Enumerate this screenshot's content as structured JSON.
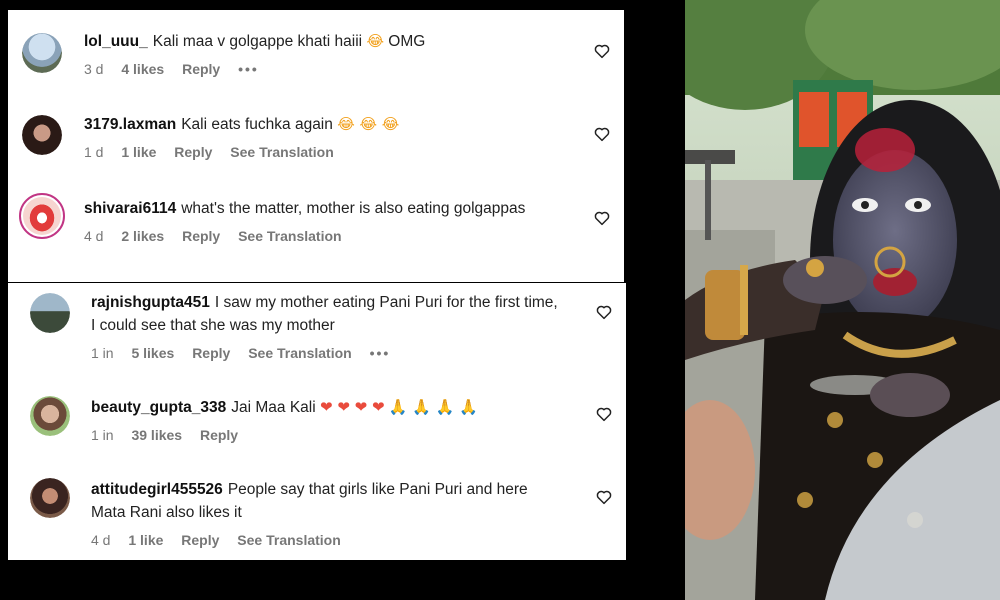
{
  "comments": [
    {
      "username": "lol_uuu_",
      "text": "Kali maa v golgappe khati haiii",
      "emoji": "😂",
      "text_after": " OMG",
      "time": "3 d",
      "likes": "4 likes",
      "reply": "Reply",
      "more": "•••"
    },
    {
      "username": "3179.laxman",
      "text": "Kali eats fuchka again",
      "emoji": "😂 😂 😂",
      "time": "1 d",
      "likes": "1 like",
      "reply": "Reply",
      "translate": "See Translation"
    },
    {
      "username": "shivarai6114",
      "text": "what's the matter, mother is also eating golgappas",
      "time": "4 d",
      "likes": "2 likes",
      "reply": "Reply",
      "translate": "See Translation"
    },
    {
      "username": "rajnishgupta451",
      "text": "I saw my mother eating Pani Puri for the first time, I could see that she was my mother",
      "time": "1 in",
      "likes": "5 likes",
      "reply": "Reply",
      "translate": "See Translation",
      "more": "•••"
    },
    {
      "username": "beauty_gupta_338",
      "text": "Jai Maa Kali",
      "emoji_hearts": "❤ ❤ ❤ ❤",
      "emoji_pray": "🙏 🙏 🙏 🙏",
      "time": "1 in",
      "likes": "39 likes",
      "reply": "Reply"
    },
    {
      "username": "attitudegirl455526",
      "text": "People say that girls like Pani Puri and here Mata Rani also likes it",
      "time": "4 d",
      "likes": "1 like",
      "reply": "Reply",
      "translate": "See Translation"
    }
  ],
  "colors": {
    "background": "#000000",
    "panel": "#ffffff",
    "text": "#222222",
    "meta": "#777777",
    "story_ring": "#c13584"
  },
  "icons": {
    "like": "heart-outline-icon",
    "more": "more-dots-icon"
  }
}
